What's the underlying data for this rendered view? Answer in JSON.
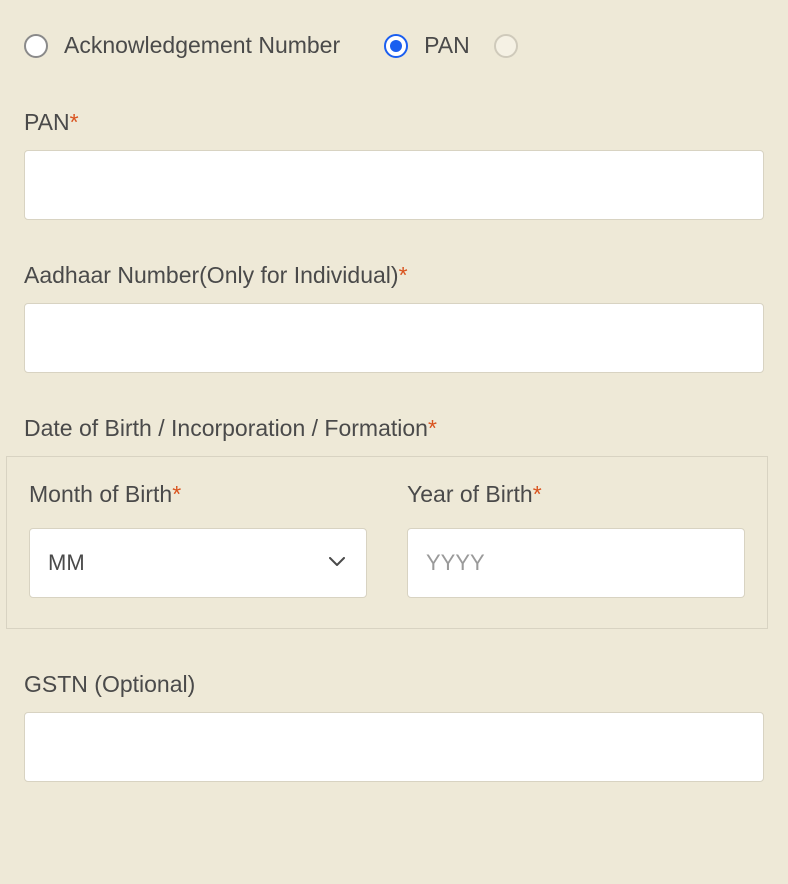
{
  "radios": {
    "ack": {
      "label": "Acknowledgement Number",
      "selected": false
    },
    "pan": {
      "label": "PAN",
      "selected": true
    }
  },
  "fields": {
    "pan": {
      "label": "PAN",
      "required": "*",
      "value": ""
    },
    "aadhaar": {
      "label": "Aadhaar Number(Only for Individual)",
      "required": "*",
      "value": ""
    },
    "dob_header": {
      "label": "Date of Birth / Incorporation / Formation",
      "required": "*"
    },
    "month": {
      "label": "Month of Birth",
      "required": "*",
      "placeholder": "MM"
    },
    "year": {
      "label": "Year of Birth",
      "required": "*",
      "placeholder": "YYYY"
    },
    "gstn": {
      "label": "GSTN (Optional)",
      "value": ""
    }
  }
}
